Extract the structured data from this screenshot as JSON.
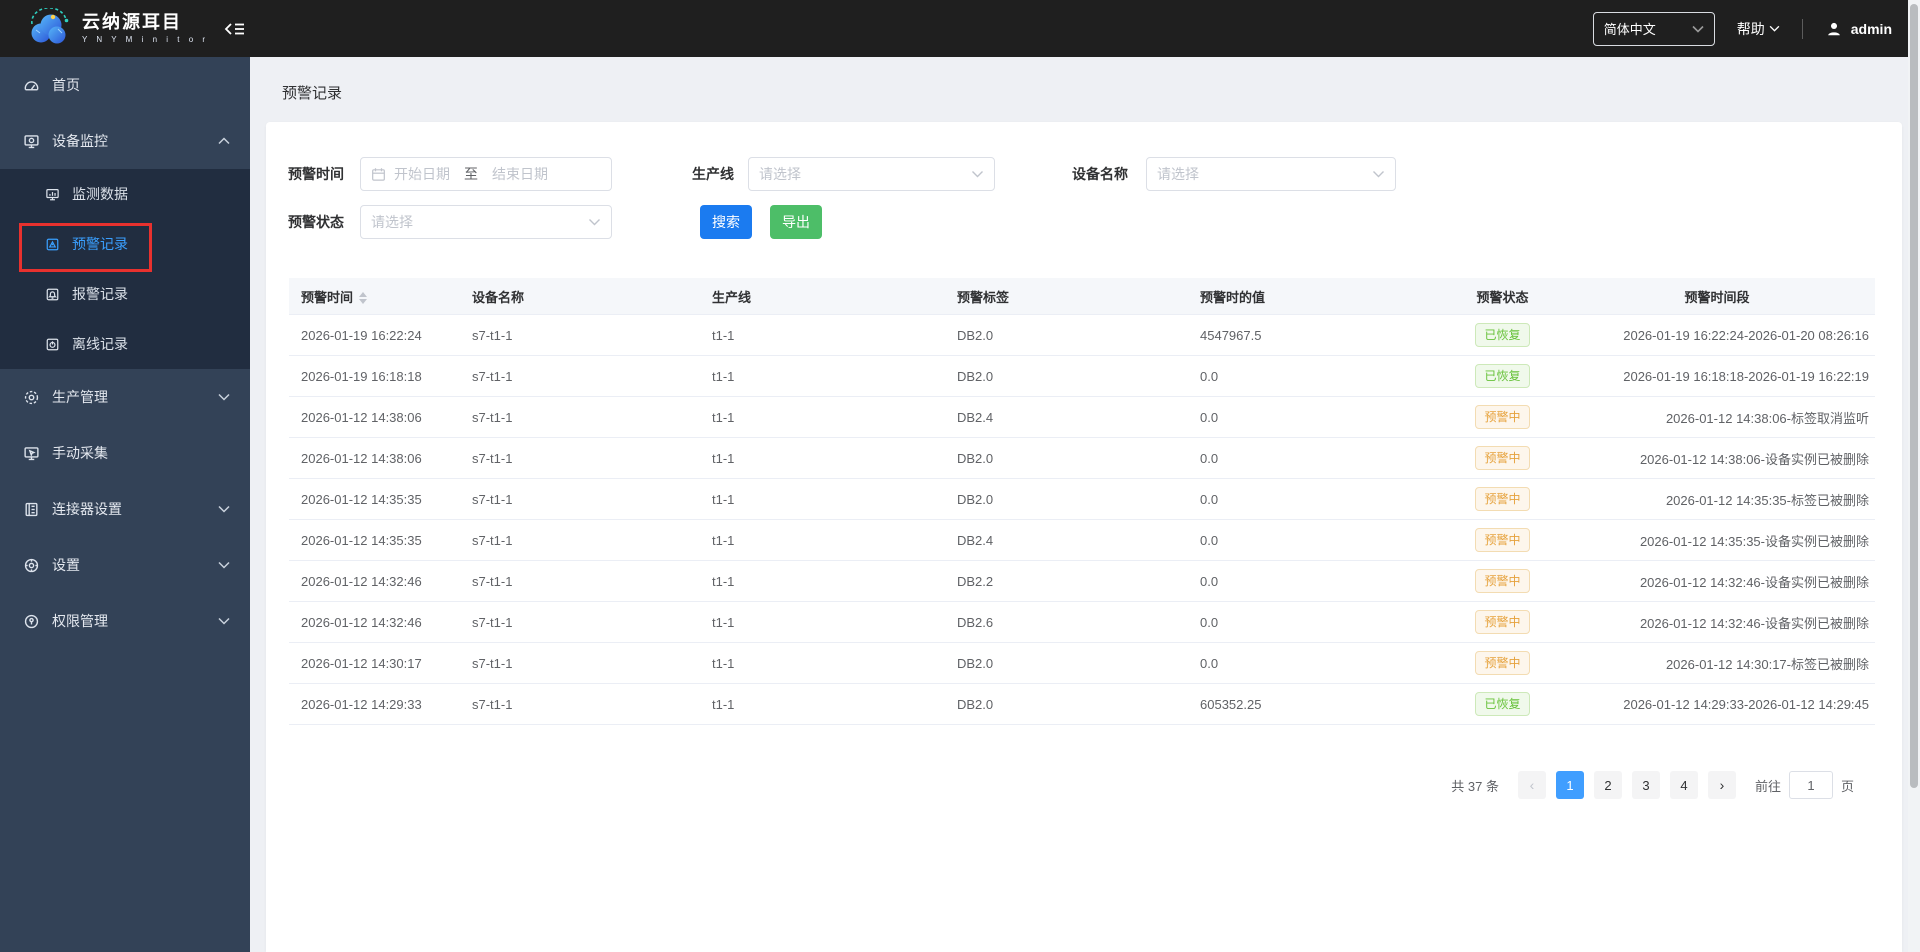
{
  "topbar": {
    "brand_title": "云纳源耳目",
    "brand_subtitle": "Y N Y M i n i t o r",
    "language": "简体中文",
    "help_label": "帮助",
    "username": "admin"
  },
  "sidebar": {
    "items": [
      {
        "name": "home",
        "label": "首页",
        "icon": "dashboard-icon"
      },
      {
        "name": "device-monitor",
        "label": "设备监控",
        "icon": "device-monitor-icon",
        "chevron": "up",
        "children": [
          {
            "name": "monitor-data",
            "label": "监测数据",
            "icon": "monitor-data-icon"
          },
          {
            "name": "warning-record",
            "label": "预警记录",
            "icon": "warning-record-icon",
            "active": true
          },
          {
            "name": "alarm-record",
            "label": "报警记录",
            "icon": "alarm-record-icon"
          },
          {
            "name": "offline-record",
            "label": "离线记录",
            "icon": "offline-record-icon"
          }
        ]
      },
      {
        "name": "production",
        "label": "生产管理",
        "icon": "production-icon",
        "chevron": "down"
      },
      {
        "name": "manual-collect",
        "label": "手动采集",
        "icon": "manual-collect-icon"
      },
      {
        "name": "connector-settings",
        "label": "连接器设置",
        "icon": "connector-icon",
        "chevron": "down"
      },
      {
        "name": "settings",
        "label": "设置",
        "icon": "settings-icon",
        "chevron": "down"
      },
      {
        "name": "permission",
        "label": "权限管理",
        "icon": "permission-icon",
        "chevron": "down"
      }
    ]
  },
  "page": {
    "title": "预警记录"
  },
  "filters": {
    "time_label": "预警时间",
    "date_start_placeholder": "开始日期",
    "date_separator": "至",
    "date_end_placeholder": "结束日期",
    "line_label": "生产线",
    "line_placeholder": "请选择",
    "device_label": "设备名称",
    "device_placeholder": "请选择",
    "status_label": "预警状态",
    "status_placeholder": "请选择",
    "search_label": "搜索",
    "export_label": "导出"
  },
  "table": {
    "columns": [
      "预警时间",
      "设备名称",
      "生产线",
      "预警标签",
      "预警时的值",
      "预警状态",
      "预警时间段"
    ],
    "rows": [
      {
        "time": "2026-01-19 16:22:24",
        "device": "s7-t1-1",
        "line": "t1-1",
        "tag": "DB2.0",
        "value": "4547967.5",
        "status": "已恢复",
        "status_type": "success",
        "period": "2026-01-19 16:22:24-2026-01-20 08:26:16"
      },
      {
        "time": "2026-01-19 16:18:18",
        "device": "s7-t1-1",
        "line": "t1-1",
        "tag": "DB2.0",
        "value": "0.0",
        "status": "已恢复",
        "status_type": "success",
        "period": "2026-01-19 16:18:18-2026-01-19 16:22:19"
      },
      {
        "time": "2026-01-12 14:38:06",
        "device": "s7-t1-1",
        "line": "t1-1",
        "tag": "DB2.4",
        "value": "0.0",
        "status": "预警中",
        "status_type": "warning",
        "period": "2026-01-12 14:38:06-标签取消监听"
      },
      {
        "time": "2026-01-12 14:38:06",
        "device": "s7-t1-1",
        "line": "t1-1",
        "tag": "DB2.0",
        "value": "0.0",
        "status": "预警中",
        "status_type": "warning",
        "period": "2026-01-12 14:38:06-设备实例已被删除"
      },
      {
        "time": "2026-01-12 14:35:35",
        "device": "s7-t1-1",
        "line": "t1-1",
        "tag": "DB2.0",
        "value": "0.0",
        "status": "预警中",
        "status_type": "warning",
        "period": "2026-01-12 14:35:35-标签已被删除"
      },
      {
        "time": "2026-01-12 14:35:35",
        "device": "s7-t1-1",
        "line": "t1-1",
        "tag": "DB2.4",
        "value": "0.0",
        "status": "预警中",
        "status_type": "warning",
        "period": "2026-01-12 14:35:35-设备实例已被删除"
      },
      {
        "time": "2026-01-12 14:32:46",
        "device": "s7-t1-1",
        "line": "t1-1",
        "tag": "DB2.2",
        "value": "0.0",
        "status": "预警中",
        "status_type": "warning",
        "period": "2026-01-12 14:32:46-设备实例已被删除"
      },
      {
        "time": "2026-01-12 14:32:46",
        "device": "s7-t1-1",
        "line": "t1-1",
        "tag": "DB2.6",
        "value": "0.0",
        "status": "预警中",
        "status_type": "warning",
        "period": "2026-01-12 14:32:46-设备实例已被删除"
      },
      {
        "time": "2026-01-12 14:30:17",
        "device": "s7-t1-1",
        "line": "t1-1",
        "tag": "DB2.0",
        "value": "0.0",
        "status": "预警中",
        "status_type": "warning",
        "period": "2026-01-12 14:30:17-标签已被删除"
      },
      {
        "time": "2026-01-12 14:29:33",
        "device": "s7-t1-1",
        "line": "t1-1",
        "tag": "DB2.0",
        "value": "605352.25",
        "status": "已恢复",
        "status_type": "success",
        "period": "2026-01-12 14:29:33-2026-01-12 14:29:45"
      }
    ]
  },
  "pagination": {
    "total_text": "共 37 条",
    "pages": [
      "1",
      "2",
      "3",
      "4"
    ],
    "active_page": "1",
    "goto_label": "前往",
    "goto_value": "1",
    "page_unit": "页"
  },
  "colors": {
    "accent": "#409eff",
    "search_button": "#1b7bf0",
    "export_button": "#4dbe68",
    "success_text": "#67c23a",
    "warning_text": "#e6a23c",
    "sidebar_bg": "#334257",
    "submenu_bg": "#212d40",
    "topbar_bg": "#1f1f1f",
    "annotation": "#e8312e"
  }
}
